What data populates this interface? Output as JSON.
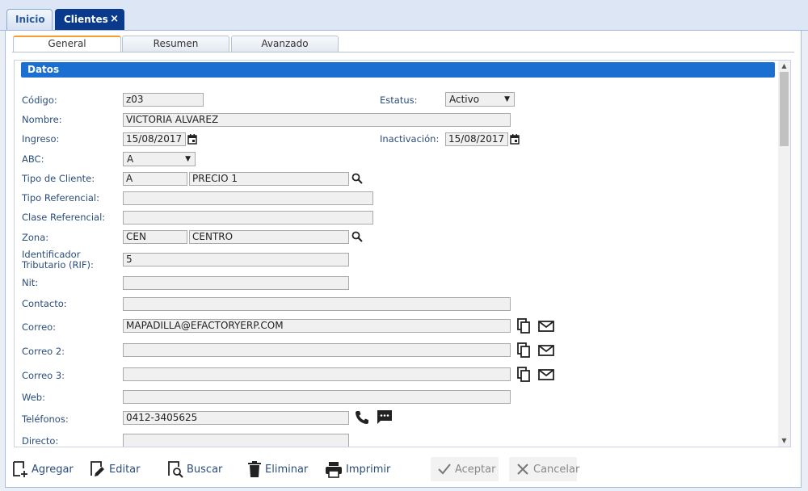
{
  "top_tabs": [
    {
      "label": "Inicio"
    },
    {
      "label": "Clientes",
      "close": "×"
    }
  ],
  "sub_tabs": [
    {
      "label": "General"
    },
    {
      "label": "Resumen"
    },
    {
      "label": "Avanzado"
    }
  ],
  "section": {
    "title": "Datos"
  },
  "form": {
    "codigo": {
      "label": "Código:",
      "value": "z03"
    },
    "estatus": {
      "label": "Estatus:",
      "value": "Activo"
    },
    "nombre": {
      "label": "Nombre:",
      "value": "VICTORIA ALVAREZ"
    },
    "ingreso": {
      "label": "Ingreso:",
      "value": "15/08/2017"
    },
    "inactivacion": {
      "label": "Inactivación:",
      "value": "15/08/2017"
    },
    "abc": {
      "label": "ABC:",
      "value": "A"
    },
    "tipo_cliente": {
      "label": "Tipo de Cliente:",
      "code": "A",
      "name": "PRECIO 1"
    },
    "tipo_referencial": {
      "label": "Tipo Referencial:",
      "value": ""
    },
    "clase_referencial": {
      "label": "Clase Referencial:",
      "value": ""
    },
    "zona": {
      "label": "Zona:",
      "code": "CEN",
      "name": "CENTRO"
    },
    "rif": {
      "label_line1": "Identificador",
      "label_line2": "Tributario (RIF):",
      "value": "5"
    },
    "nit": {
      "label": "Nit:",
      "value": ""
    },
    "contacto": {
      "label": "Contacto:",
      "value": ""
    },
    "correo": {
      "label": "Correo:",
      "value": "MAPADILLA@EFACTORYERP.COM"
    },
    "correo2": {
      "label": "Correo 2:",
      "value": ""
    },
    "correo3": {
      "label": "Correo 3:",
      "value": ""
    },
    "web": {
      "label": "Web:",
      "value": ""
    },
    "telefonos": {
      "label": "Teléfonos:",
      "value": "0412-3405625"
    },
    "directo": {
      "label": "Directo:",
      "value": ""
    }
  },
  "toolbar": {
    "agregar": "Agregar",
    "editar": "Editar",
    "buscar": "Buscar",
    "eliminar": "Eliminar",
    "imprimir": "Imprimir",
    "aceptar": "Aceptar",
    "cancelar": "Cancelar"
  },
  "colors": {
    "accent": "#1a6fd0",
    "active_tab": "#0a3a8c",
    "label": "#2b4d7a",
    "subtab_highlight": "#f0a030"
  },
  "icons": [
    "calendar-icon",
    "search-icon",
    "copy-icon",
    "mail-icon",
    "phone-icon",
    "message-icon"
  ]
}
